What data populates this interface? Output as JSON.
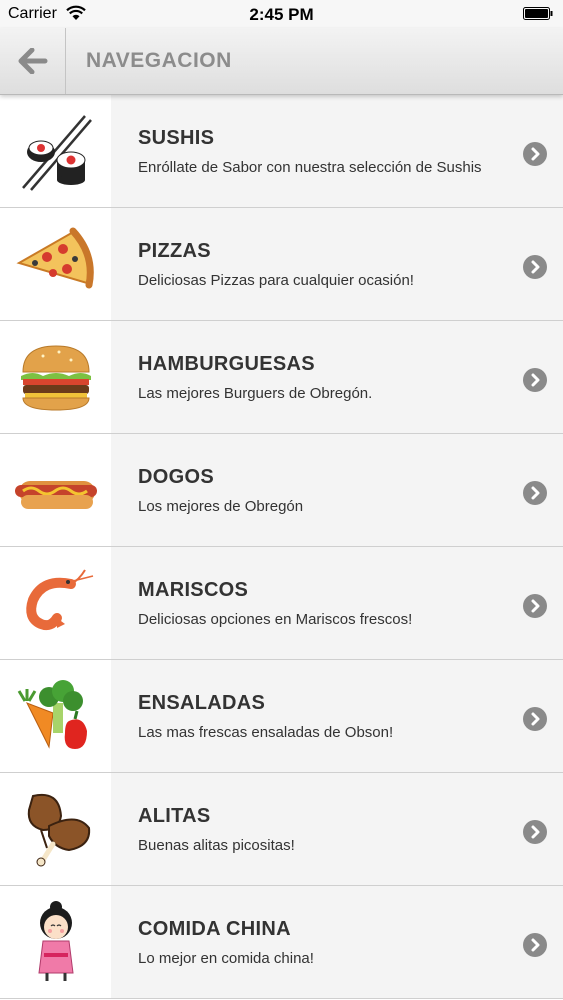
{
  "status_bar": {
    "carrier": "Carrier",
    "time": "2:45 PM",
    "icons": [
      "wifi-icon",
      "battery-icon"
    ]
  },
  "nav_bar": {
    "back_icon": "arrow-left-icon",
    "title": "NAVEGACION"
  },
  "categories": [
    {
      "title": "SUSHIS",
      "subtitle": "Enróllate de Sabor con nuestra selección de Sushis",
      "icon": "sushi-icon"
    },
    {
      "title": "PIZZAS",
      "subtitle": "Deliciosas Pizzas para cualquier ocasión!",
      "icon": "pizza-icon"
    },
    {
      "title": "HAMBURGUESAS",
      "subtitle": "Las mejores Burguers de Obregón.",
      "icon": "burger-icon"
    },
    {
      "title": "DOGOS",
      "subtitle": "Los mejores de Obregón",
      "icon": "hotdog-icon"
    },
    {
      "title": "MARISCOS",
      "subtitle": "Deliciosas opciones en Mariscos frescos!",
      "icon": "shrimp-icon"
    },
    {
      "title": "ENSALADAS",
      "subtitle": "Las mas frescas ensaladas de Obson!",
      "icon": "salad-icon"
    },
    {
      "title": "ALITAS",
      "subtitle": "Buenas alitas picositas!",
      "icon": "chicken-wings-icon"
    },
    {
      "title": "COMIDA CHINA",
      "subtitle": "Lo mejor en comida china!",
      "icon": "chinese-doll-icon"
    }
  ],
  "colors": {
    "nav_title": "#8c8c8c",
    "row_bg": "#f4f4f4",
    "chevron": "#8a8a8a"
  }
}
